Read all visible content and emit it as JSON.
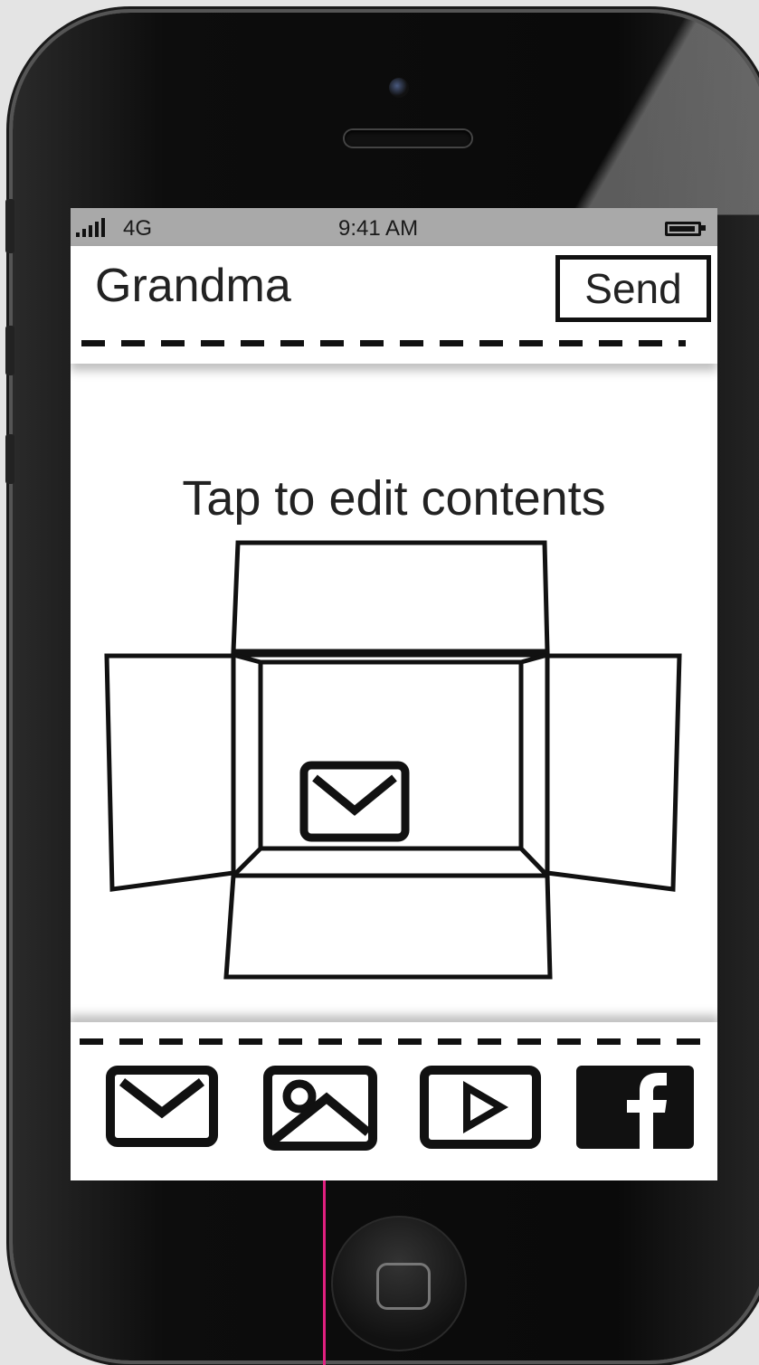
{
  "status_bar": {
    "network": "4G",
    "time": "9:41 AM"
  },
  "header": {
    "title": "Grandma",
    "send_label": "Send"
  },
  "main": {
    "hint": "Tap to edit contents",
    "box_contents_icon": "envelope-icon"
  },
  "toolbar": {
    "tools": [
      "mail-icon",
      "image-icon",
      "video-play-icon",
      "facebook-icon"
    ]
  },
  "colors": {
    "status_bar": "#a9a9a9",
    "annotation_line": "#e0207f"
  }
}
